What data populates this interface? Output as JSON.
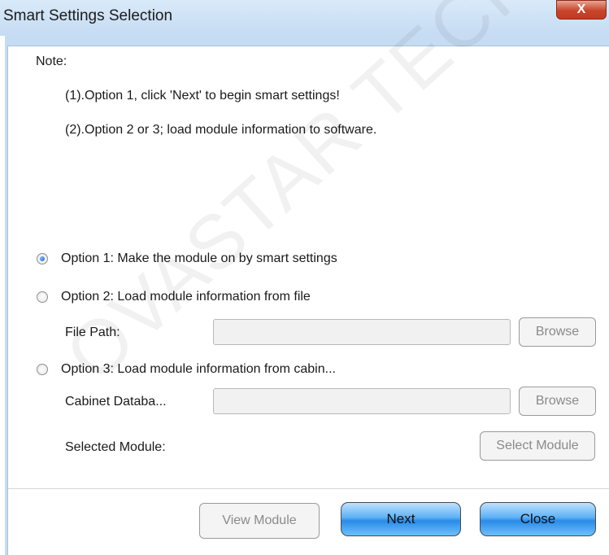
{
  "window": {
    "title": "Smart Settings Selection",
    "close_glyph": "X"
  },
  "note": {
    "heading": "Note:",
    "line1": "(1).Option 1, click 'Next' to begin smart settings!",
    "line2": "(2).Option 2 or 3; load module information to software."
  },
  "options": [
    {
      "label": "Option 1: Make the module on by smart settings",
      "checked": true
    },
    {
      "label": "Option 2: Load module information from file",
      "checked": false
    },
    {
      "label": "Option 3: Load module information from cabin...",
      "checked": false
    }
  ],
  "file_path": {
    "label": "File Path:",
    "value": "",
    "browse_label": "Browse"
  },
  "cabinet_db": {
    "label": "Cabinet Databa...",
    "value": "",
    "browse_label": "Browse"
  },
  "selected_module": {
    "label": "Selected Module:",
    "button_label": "Select Module"
  },
  "footer": {
    "view_module_label": "View Module",
    "next_label": "Next",
    "close_label": "Close"
  },
  "watermark": "OVASTAR TECH CO"
}
